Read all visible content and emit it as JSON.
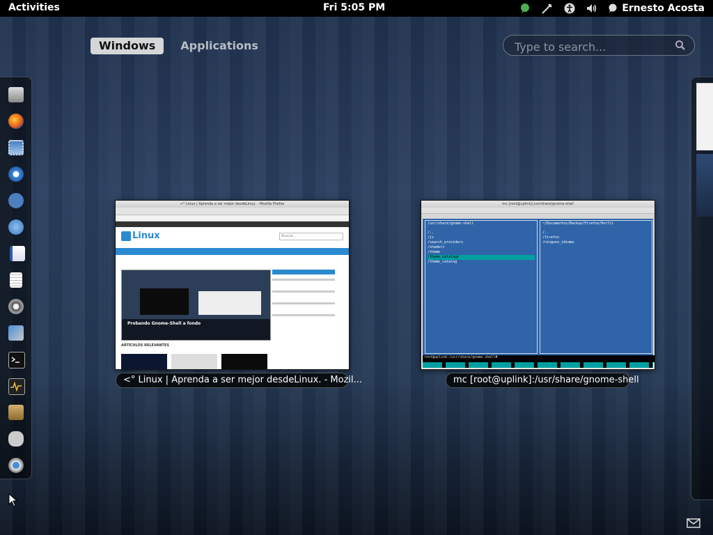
{
  "topbar": {
    "activities_label": "Activities",
    "clock": "Fri  5:05 PM",
    "status_icons": [
      "chat-status-icon",
      "network-icon",
      "accessibility-icon",
      "volume-icon"
    ],
    "user_name": "Ernesto Acosta"
  },
  "overview": {
    "tabs": [
      {
        "label": "Windows",
        "active": true
      },
      {
        "label": "Applications",
        "active": false
      }
    ],
    "search_placeholder": "Type to search..."
  },
  "dash": {
    "items": [
      "file-cabinet-icon",
      "firefox-icon",
      "mail-client-icon",
      "chromium-icon",
      "chat-icon",
      "messenger-icon",
      "document-icon",
      "text-editor-icon",
      "settings-gear-icon",
      "tools-icon",
      "terminal-icon",
      "system-monitor-icon",
      "package-manager-icon",
      "gnome-foot-icon",
      "pidgin-icon"
    ]
  },
  "windows": [
    {
      "caption": "<° Linux | Aprenda a ser mejor desdeLinux. - Mozil...",
      "inner_title": "<° Linux | Aprenda a ser mejor desdeLinux. - Mozilla Firefox",
      "site_logo": "Linux",
      "article_title": "Probando Gnome-Shell a fondo",
      "section_title": "ARTÍCULOS RELEVANTES",
      "search_placeholder": "Buscar..."
    },
    {
      "caption": "mc [root@uplink]:/usr/share/gnome-shell",
      "inner_title": "mc [root@uplink]:/usr/share/gnome-shell",
      "left_path": "/usr/share/gnome-shell",
      "right_path": "~/Documentos/Backup/Firefox/Perfil",
      "left_entries": [
        "/..",
        "/js",
        "/search_providers",
        "/shaders",
        "/theme",
        "/theme_catalogs",
        "/theme_catalog"
      ],
      "right_entries": [
        "/..",
        "/firefox",
        "/ninguno_idioma"
      ],
      "command_line": "root@uplink:/usr/share/gnome-shell#"
    }
  ],
  "colors": {
    "topbar": "#000000",
    "active_tab_bg": "#d4d6d8",
    "mc_panel": "#2f64a8",
    "mc_highlight": "#00a0a0"
  }
}
